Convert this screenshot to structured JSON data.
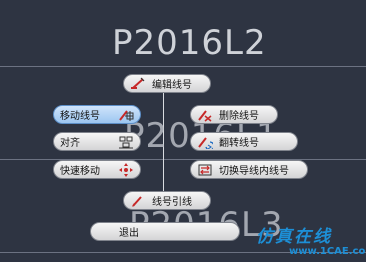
{
  "labels": {
    "top": "P2016L2",
    "middle": "P2016L1",
    "bottom": "P2016L3"
  },
  "menu": {
    "edit_label": "编辑线号",
    "move_label": "移动线号",
    "delete_label": "删除线号",
    "align_label": "对齐",
    "flip_label": "翻转线号",
    "quick_move_label": "快速移动",
    "switch_label": "切换导线内线号",
    "leader_label": "线号引线",
    "exit_label": "退出",
    "selected_item": "移动线号"
  },
  "icons": {
    "edit": "edit-wire-number-icon",
    "move": "move-wire-number-icon",
    "delete": "delete-wire-number-icon",
    "align": "align-icon",
    "flip": "flip-wire-number-icon",
    "quick_move": "quick-move-icon",
    "switch": "switch-wire-number-icon",
    "leader": "wire-number-leader-icon"
  },
  "watermark": {
    "text": "仿真在线",
    "url": "www.1CAE.com"
  },
  "colors": {
    "background": "#2e3442",
    "menu_button": "#e6e6e8",
    "selected_button": "#a9cdf3",
    "watermark": "#1d8fd6"
  }
}
